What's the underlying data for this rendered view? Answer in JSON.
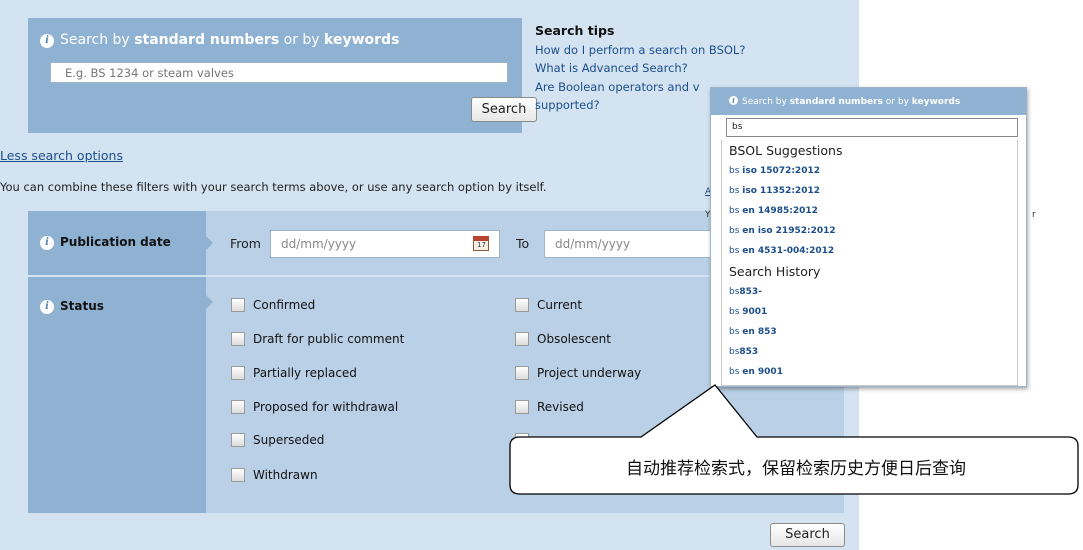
{
  "search": {
    "head_pre": "Search by",
    "head_b1": "standard numbers",
    "head_mid": "or by",
    "head_b2": "keywords",
    "placeholder": "E.g. BS 1234 or steam valves",
    "button": "Search"
  },
  "tips": {
    "title": "Search tips",
    "links": [
      "How do I perform a search on BSOL?",
      "What is Advanced Search?",
      "Are Boolean operators and v",
      "supported?"
    ]
  },
  "filters": {
    "less_link": "Less search options",
    "combine_text": "You can combine these filters with your search terms above, or use any search option by itself.",
    "publication_label": "Publication date",
    "from_label": "From",
    "to_label": "To",
    "date_placeholder": "dd/mm/yyyy",
    "status_label": "Status",
    "status_left": [
      "Confirmed",
      "Draft for public comment",
      "Partially replaced",
      "Proposed for withdrawal",
      "Superseded",
      "Withdrawn"
    ],
    "status_right": [
      "Current",
      "Obsolescent",
      "Project underway",
      "Revised"
    ],
    "bottom_button": "Search",
    "calendar_day": "17"
  },
  "autocomplete": {
    "head_pre": "Search by",
    "head_b1": "standard numbers",
    "head_mid": "or by",
    "head_b2": "keywords",
    "input_value": "bs",
    "suggestions_title": "BSOL Suggestions",
    "suggestions": [
      {
        "pre": "bs ",
        "bold": "iso 15072:2012"
      },
      {
        "pre": "bs ",
        "bold": "iso 11352:2012"
      },
      {
        "pre": "bs ",
        "bold": "en 14985:2012"
      },
      {
        "pre": "bs ",
        "bold": "en iso 21952:2012"
      },
      {
        "pre": "bs ",
        "bold": "en 4531-004:2012"
      }
    ],
    "history_title": "Search History",
    "history": [
      {
        "pre": "bs",
        "bold": "853-"
      },
      {
        "pre": "bs ",
        "bold": "9001"
      },
      {
        "pre": "bs ",
        "bold": "en 853"
      },
      {
        "pre": "bs",
        "bold": "853"
      },
      {
        "pre": "bs ",
        "bold": "en 9001"
      }
    ]
  },
  "behind_fragments": {
    "a": "A",
    "y": "Y",
    "r": "r"
  },
  "callout": "自动推荐检索式，保留检索历史方便日后查询",
  "colors": {
    "panel": "#d3e3f2",
    "header_blue": "#8fb2d3",
    "filter_blue": "#bad0e6",
    "link": "#1c4e8a"
  }
}
